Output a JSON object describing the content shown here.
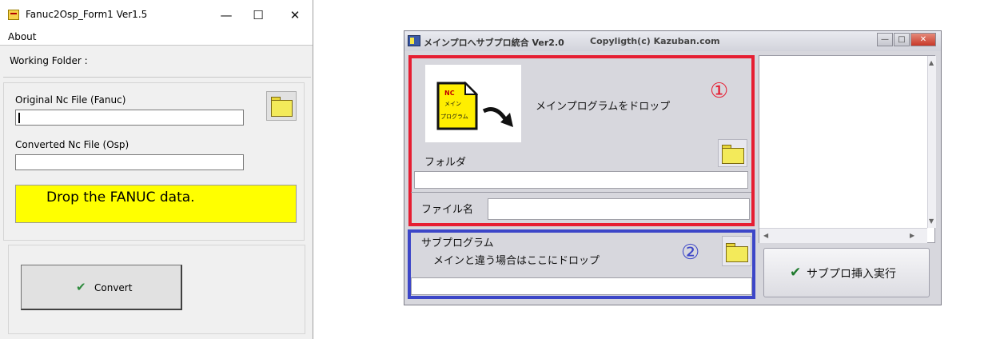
{
  "left_window": {
    "title": "Fanuc2Osp_Form1 Ver1.5",
    "controls": {
      "minimize": "—",
      "maximize": "☐",
      "close": "✕"
    },
    "menu": {
      "about": "About"
    },
    "working_folder_label": "Working Folder :",
    "original_label": "Original Nc File (Fanuc)",
    "original_value": "",
    "converted_label": "Converted Nc File (Osp)",
    "converted_value": "",
    "drop_text": "Drop the FANUC data.",
    "convert_label": "Convert",
    "colors": {
      "drop_bg": "#ffff00",
      "check": "#2e8b3d"
    }
  },
  "right_window": {
    "title": "メインプロへサブプロ統合 Ver2.0",
    "copyright": "Copyligth(c)  Kazuban.com",
    "controls": {
      "minimize": "—",
      "maximize": "□",
      "close": "✕"
    },
    "doc_icon": {
      "line1": "NC",
      "line2": "メイン",
      "line3": "プログラム"
    },
    "main_drop_label": "メインプログラムをドロップ",
    "number_1": "①",
    "folder_label": "フォルダ",
    "folder_value": "",
    "filename_label": "ファイル名",
    "filename_value": "",
    "sub_title": "サブプログラム",
    "sub_hint": "メインと違う場合はここにドロップ",
    "number_2": "②",
    "sub_value": "",
    "run_label": "サブプロ挿入実行",
    "colors": {
      "red_box": "#e61e32",
      "blue_box": "#3c46c8",
      "check": "#1f7a2d"
    }
  }
}
